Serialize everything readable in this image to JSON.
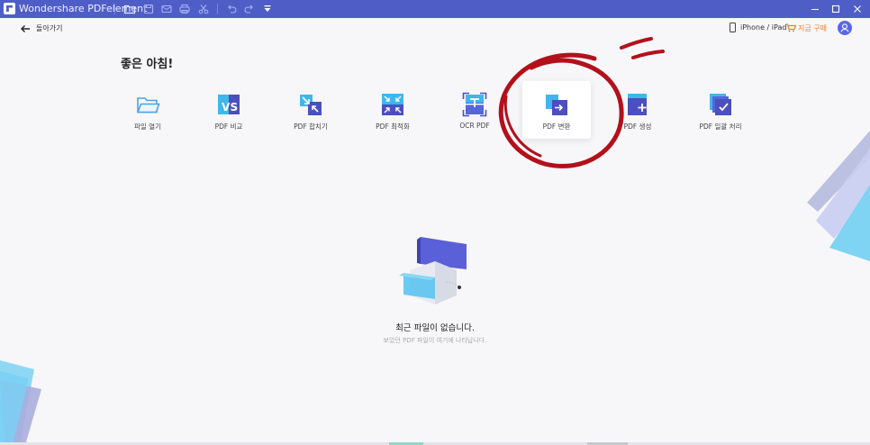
{
  "titlebar": {
    "app_title": "Wondershare PDFelement",
    "icons": [
      "folder-icon",
      "save-icon",
      "mail-icon",
      "print-icon",
      "cut-icon",
      "undo-icon",
      "redo-icon",
      "dropdown-icon"
    ],
    "window_controls": [
      "minimize-icon",
      "maximize-icon",
      "close-icon"
    ]
  },
  "topbar": {
    "back_label": "돌아가기",
    "device_label": "iPhone / iPad",
    "buy_label": "지금 구매"
  },
  "greeting": "좋은 아침!",
  "tools": [
    {
      "label": "파일 열기",
      "icon": "open-folder-icon"
    },
    {
      "label": "PDF 비교",
      "icon": "compare-vs-icon"
    },
    {
      "label": "PDF 합치기",
      "icon": "combine-icon"
    },
    {
      "label": "PDF 최적화",
      "icon": "optimize-icon"
    },
    {
      "label": "OCR PDF",
      "icon": "ocr-icon"
    },
    {
      "label": "PDF 변환",
      "icon": "convert-icon"
    },
    {
      "label": "PDF 생성",
      "icon": "create-icon"
    },
    {
      "label": "PDF 일괄 처리",
      "icon": "batch-icon"
    }
  ],
  "empty_state": {
    "title": "최근 파일이 없습니다.",
    "subtitle": "보았던 PDF 파일이 여기에 나타납니다."
  },
  "colors": {
    "titlebar": "#4f5ec7",
    "accent": "#5a66e8",
    "buy": "#f07d36",
    "annotation": "#b3101c"
  }
}
